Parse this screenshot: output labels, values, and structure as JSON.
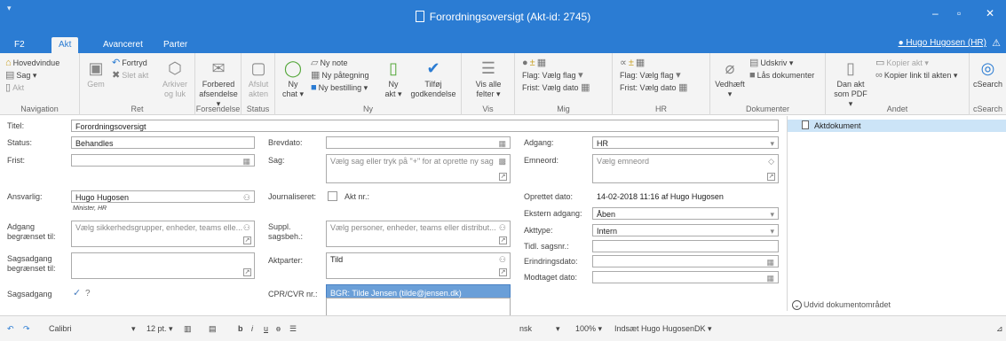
{
  "window": {
    "title": "Forordningsoversigt (Akt-id: 2745)",
    "qa_glyph": "▾",
    "min": "‒",
    "max": "▫",
    "close": "✕"
  },
  "tabs": [
    {
      "label": "F2"
    },
    {
      "label": "Akt"
    },
    {
      "label": "Avanceret"
    },
    {
      "label": "Parter"
    }
  ],
  "user": {
    "label": "Hugo Hugosen (HR)",
    "warn": "⚠"
  },
  "ribbon": {
    "navigation": {
      "label": "Navigation",
      "hovedvindue": "Hovedvindue",
      "sag": "Sag ▾",
      "akt": "Akt"
    },
    "ret": {
      "label": "Ret",
      "gem": "Gem",
      "fortryd": "Fortryd",
      "slet_akt": "Slet akt",
      "arkiver": "Arkiver",
      "og_luk": "og luk"
    },
    "forsendelse": {
      "label": "Forsendelse",
      "line1": "Forbered",
      "line2": "afsendelse ▾"
    },
    "status": {
      "label": "Status",
      "line1": "Afslut",
      "line2": "akten"
    },
    "ny": {
      "label": "Ny",
      "ny_chat_1": "Ny",
      "ny_chat_2": "chat ▾",
      "ny_note": "Ny note",
      "ny_paategning": "Ny påtegning",
      "ny_bestilling": "Ny bestilling ▾",
      "ny_akt_1": "Ny",
      "ny_akt_2": "akt ▾",
      "tilfoej_1": "Tilføj",
      "tilfoej_2": "godkendelse"
    },
    "vis": {
      "label": "Vis",
      "line1": "Vis alle",
      "line2": "felter ▾",
      "line3": "Vis"
    },
    "mig": {
      "label": "Mig",
      "flag": "Flag:",
      "flag_val": "Vælg flag",
      "frist": "Frist:",
      "frist_val": "Vælg dato"
    },
    "hr": {
      "label": "HR",
      "flag": "Flag:",
      "flag_val": "Vælg flag",
      "frist": "Frist:",
      "frist_val": "Vælg dato"
    },
    "dokumenter": {
      "label": "Dokumenter",
      "vedhaeft": "Vedhæft",
      "vedhaeft_arrow": "▾",
      "udskriv": "Udskriv ▾",
      "laas": "Lås dokumenter"
    },
    "andet": {
      "label": "Andet",
      "dan_akt_1": "Dan akt",
      "dan_akt_2": "som PDF ▾",
      "kopier_akt": "Kopier akt ▾",
      "kopier_link": "Kopier link til akten ▾"
    },
    "csearch": {
      "label": "cSearch",
      "btn": "cSearch"
    }
  },
  "form": {
    "titel_label": "Titel:",
    "titel_value": "Forordningsoversigt",
    "status_label": "Status:",
    "status_value": "Behandles",
    "frist_label": "Frist:",
    "brevdato_label": "Brevdato:",
    "sag_label": "Sag:",
    "sag_placeholder": "Vælg sag eller tryk på \"+\" for at oprette ny sag",
    "adgang_label": "Adgang:",
    "adgang_value": "HR",
    "emneord_label": "Emneord:",
    "emneord_placeholder": "Vælg emneord",
    "ansvarlig_label": "Ansvarlig:",
    "ansvarlig_value": "Hugo Hugosen",
    "ansvarlig_sub": "Minister, HR",
    "journaliseret_label": "Journaliseret:",
    "aktnr_label": "Akt nr.:",
    "oprettet_label": "Oprettet dato:",
    "oprettet_value": "14-02-2018 11:16   af   Hugo Hugosen",
    "ekstern_label": "Ekstern adgang:",
    "ekstern_value": "Åben",
    "adgang_begr_label_1": "Adgang",
    "adgang_begr_label_2": "begrænset til:",
    "adgang_begr_placeholder": "Vælg sikkerhedsgrupper, enheder, teams elle...",
    "suppl_label_1": "Suppl.",
    "suppl_label_2": "sagsbeh.:",
    "suppl_placeholder": "Vælg personer, enheder, teams eller distribut...",
    "akttype_label": "Akttype:",
    "akttype_value": "Intern",
    "tidl_label": "Tidl. sagsnr.:",
    "sagsadgang_begr_label_1": "Sagsadgang",
    "sagsadgang_begr_label_2": "begrænset til:",
    "aktparter_label": "Aktparter:",
    "aktparter_value": "Tild",
    "erindring_label": "Erindringsdato:",
    "modtaget_label": "Modtaget dato:",
    "sagsadgang_label": "Sagsadgang",
    "cpr_label": "CPR/CVR nr.:",
    "suggestion": "BGR: Tilde Jensen (tilde@jensen.dk)"
  },
  "rightpane": {
    "aktdokument": "Aktdokument",
    "expand": "Udvid dokumentområdet"
  },
  "statusbar": {
    "font": "Calibri",
    "size": "12 pt. ▾",
    "bold": "b",
    "italic": "i",
    "underline": "u",
    "strike": "ɵ",
    "lang": "nsk",
    "zoom": "100% ▾",
    "insert": "Indsæt Hugo HugosenDK ▾"
  },
  "colors": {
    "accent": "#2b7cd3",
    "selection": "#cce4f7",
    "suggestion_bg": "#6a9fd8"
  }
}
